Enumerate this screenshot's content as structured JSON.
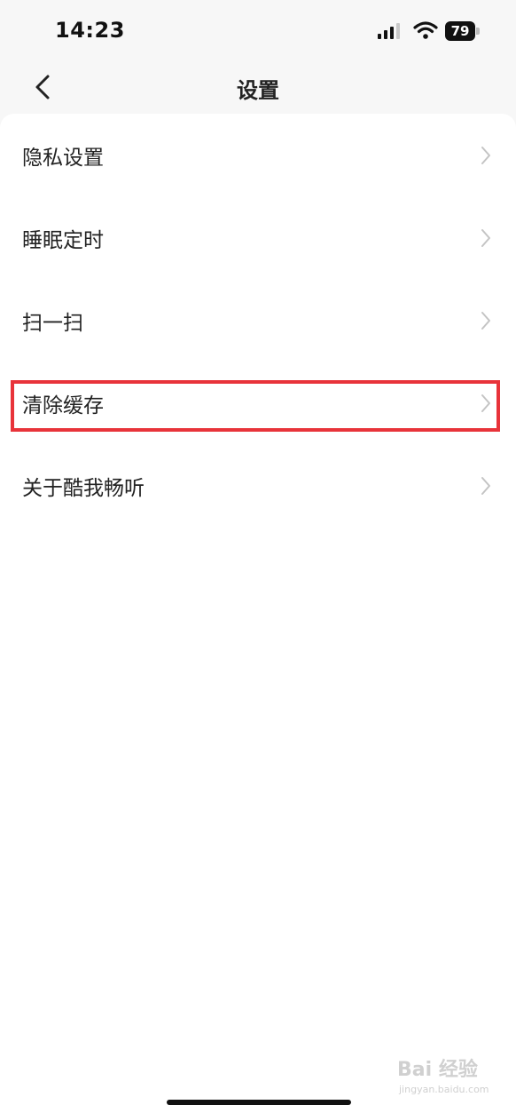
{
  "status_bar": {
    "time": "14:23",
    "battery": "79"
  },
  "nav": {
    "title": "设置"
  },
  "settings": {
    "items": [
      {
        "label": "隐私设置"
      },
      {
        "label": "睡眠定时"
      },
      {
        "label": "扫一扫"
      },
      {
        "label": "清除缓存"
      },
      {
        "label": "关于酷我畅听"
      }
    ]
  },
  "watermark": {
    "main": "Bai 经验",
    "sub": "jingyan.baidu.com"
  },
  "colors": {
    "highlight": "#e8333a",
    "background": "#f7f7f7",
    "sheet": "#ffffff"
  }
}
